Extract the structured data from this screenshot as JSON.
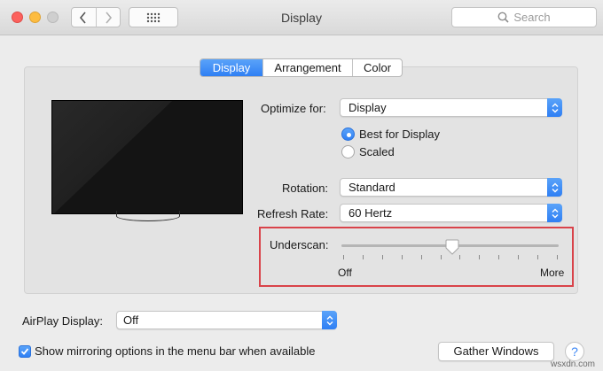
{
  "window": {
    "title": "Display",
    "search_placeholder": "Search"
  },
  "tabs": [
    {
      "label": "Display",
      "active": true
    },
    {
      "label": "Arrangement",
      "active": false
    },
    {
      "label": "Color",
      "active": false
    }
  ],
  "display_settings": {
    "optimize_for": {
      "label": "Optimize for:",
      "value": "Display"
    },
    "resolution_options": [
      {
        "label": "Best for Display",
        "selected": true
      },
      {
        "label": "Scaled",
        "selected": false
      }
    ],
    "rotation": {
      "label": "Rotation:",
      "value": "Standard"
    },
    "refresh_rate": {
      "label": "Refresh Rate:",
      "value": "60 Hertz"
    },
    "underscan": {
      "label": "Underscan:",
      "min_label": "Off",
      "max_label": "More",
      "level": 0.5
    }
  },
  "airplay": {
    "label": "AirPlay Display:",
    "value": "Off"
  },
  "mirroring_checkbox": {
    "label": "Show mirroring options in the menu bar when available",
    "checked": true
  },
  "gather_windows_label": "Gather Windows",
  "help_label": "?",
  "watermark": "wsxdn.com",
  "colors": {
    "accent": "#3b86f5",
    "highlight_box": "#d9434a",
    "window_bg": "#ececec"
  },
  "icons": [
    "back-chevron-icon",
    "forward-chevron-icon",
    "grid-icon",
    "search-icon",
    "popup-arrows-icon",
    "checkmark-icon"
  ]
}
